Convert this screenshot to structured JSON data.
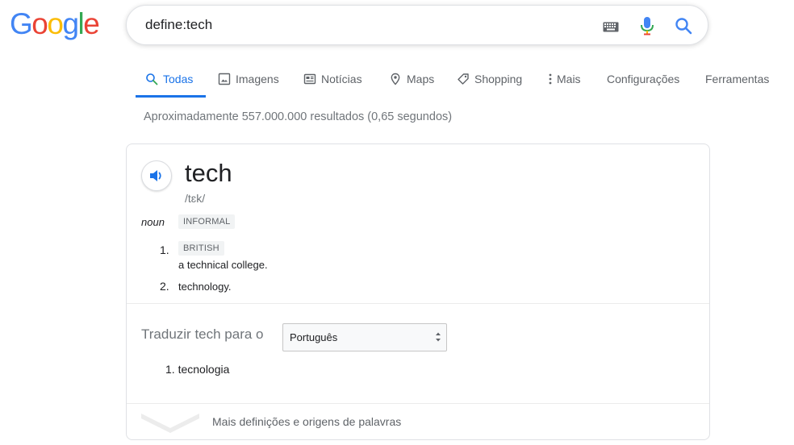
{
  "logo": {
    "letters": [
      "G",
      "o",
      "o",
      "g",
      "l",
      "e"
    ],
    "colors": [
      "#4285F4",
      "#EA4335",
      "#FBBC05",
      "#4285F4",
      "#34A853",
      "#EA4335"
    ]
  },
  "search": {
    "query": "define:tech",
    "icons": [
      "keyboard-icon",
      "microphone-icon",
      "search-icon"
    ]
  },
  "tabs": [
    {
      "label": "Todas",
      "icon": "search-icon",
      "active": true
    },
    {
      "label": "Imagens",
      "icon": "image-icon",
      "active": false
    },
    {
      "label": "Notícias",
      "icon": "news-icon",
      "active": false
    },
    {
      "label": "Maps",
      "icon": "map-pin-icon",
      "active": false
    },
    {
      "label": "Shopping",
      "icon": "tag-icon",
      "active": false
    },
    {
      "label": "Mais",
      "icon": "more-vert-icon",
      "active": false
    },
    {
      "label": "Configurações",
      "icon": "",
      "active": false
    },
    {
      "label": "Ferramentas",
      "icon": "",
      "active": false
    }
  ],
  "stats": "Aproximadamente 557.000.000 resultados (0,65 segundos)",
  "dictionary": {
    "word": "tech",
    "phonetic": "/tɛk/",
    "part_of_speech": "noun",
    "register": "INFORMAL",
    "definitions": [
      {
        "number": "1.",
        "label": "BRITISH",
        "text": "a technical college."
      },
      {
        "number": "2.",
        "label": "",
        "text": "technology."
      }
    ]
  },
  "translate": {
    "label": "Traduzir tech para o",
    "selected_language": "Português",
    "results": [
      "1. tecnologia"
    ]
  },
  "more": {
    "label": "Mais definições e origens de palavras"
  },
  "colors": {
    "accent": "#1a73e8",
    "text_secondary": "#70757a"
  }
}
